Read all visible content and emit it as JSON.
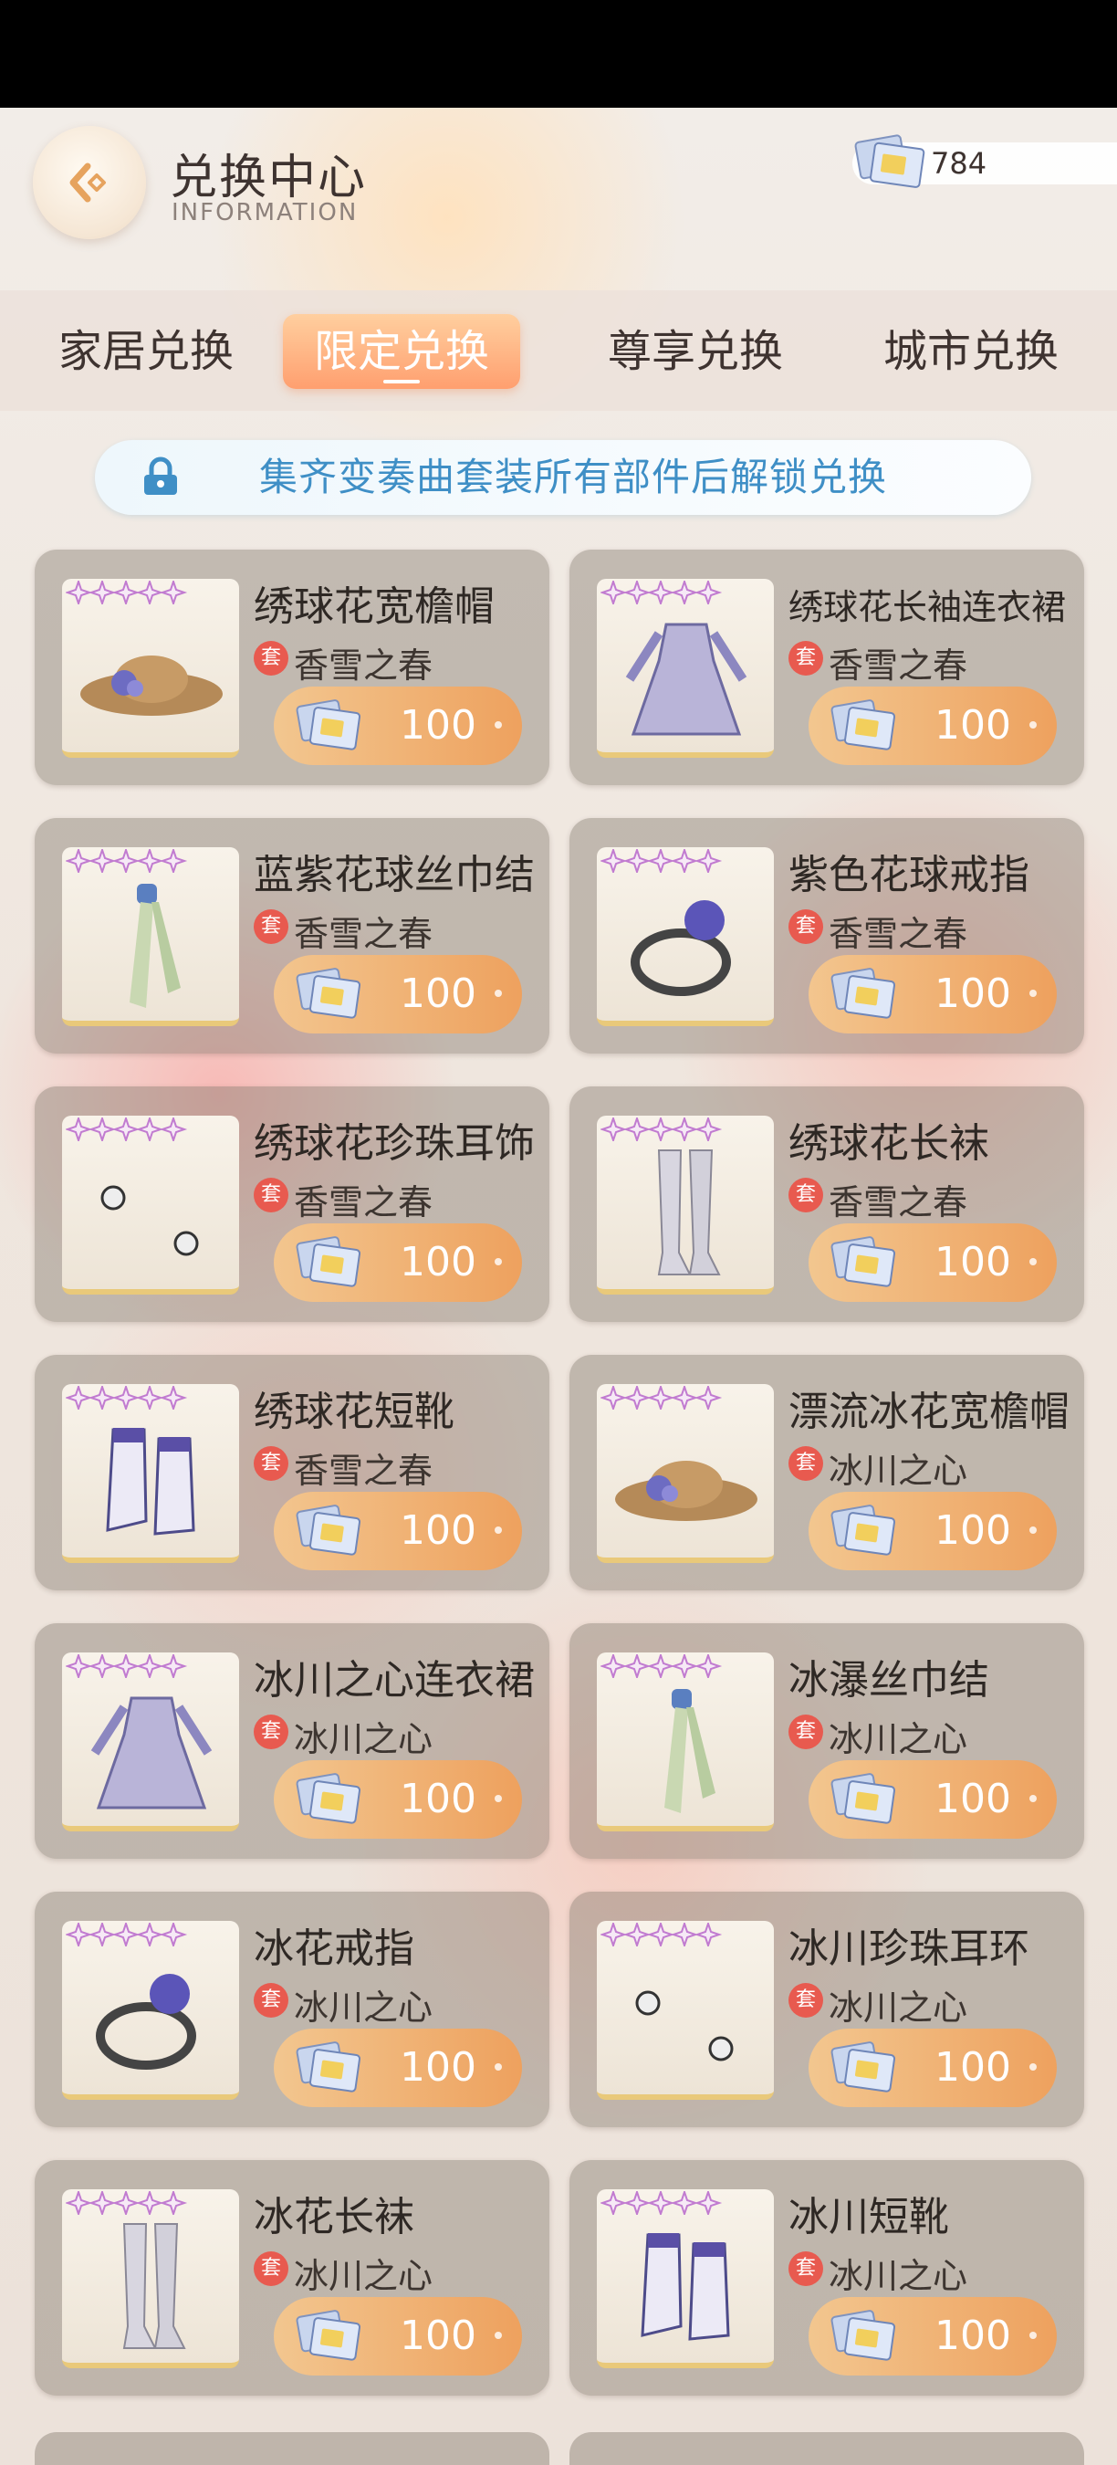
{
  "header": {
    "title": "兑换中心",
    "subtitle": "INFORMATION",
    "currency_value": "784"
  },
  "tabs": [
    {
      "label": "家居兑换",
      "active": false
    },
    {
      "label": "限定兑换",
      "active": true
    },
    {
      "label": "尊享兑换",
      "active": false
    },
    {
      "label": "城市兑换",
      "active": false
    }
  ],
  "notice": {
    "text": "集齐变奏曲套装所有部件后解锁兑换"
  },
  "items": [
    {
      "name": "绣球花宽檐帽",
      "set_badge": "套",
      "set": "香雪之春",
      "price": "100",
      "icon": "hat-icon"
    },
    {
      "name": "绣球花长袖连衣裙",
      "set_badge": "套",
      "set": "香雪之春",
      "price": "100",
      "icon": "dress-icon"
    },
    {
      "name": "蓝紫花球丝巾结",
      "set_badge": "套",
      "set": "香雪之春",
      "price": "100",
      "icon": "scarf-icon"
    },
    {
      "name": "紫色花球戒指",
      "set_badge": "套",
      "set": "香雪之春",
      "price": "100",
      "icon": "ring-icon"
    },
    {
      "name": "绣球花珍珠耳饰",
      "set_badge": "套",
      "set": "香雪之春",
      "price": "100",
      "icon": "earring-icon"
    },
    {
      "name": "绣球花长袜",
      "set_badge": "套",
      "set": "香雪之春",
      "price": "100",
      "icon": "stockings-icon"
    },
    {
      "name": "绣球花短靴",
      "set_badge": "套",
      "set": "香雪之春",
      "price": "100",
      "icon": "boots-icon"
    },
    {
      "name": "漂流冰花宽檐帽",
      "set_badge": "套",
      "set": "冰川之心",
      "price": "100",
      "icon": "hat-icon"
    },
    {
      "name": "冰川之心连衣裙",
      "set_badge": "套",
      "set": "冰川之心",
      "price": "100",
      "icon": "dress-icon"
    },
    {
      "name": "冰瀑丝巾结",
      "set_badge": "套",
      "set": "冰川之心",
      "price": "100",
      "icon": "scarf-icon"
    },
    {
      "name": "冰花戒指",
      "set_badge": "套",
      "set": "冰川之心",
      "price": "100",
      "icon": "ring-icon"
    },
    {
      "name": "冰川珍珠耳环",
      "set_badge": "套",
      "set": "冰川之心",
      "price": "100",
      "icon": "earring-icon"
    },
    {
      "name": "冰花长袜",
      "set_badge": "套",
      "set": "冰川之心",
      "price": "100",
      "icon": "stockings-icon"
    },
    {
      "name": "冰川短靴",
      "set_badge": "套",
      "set": "冰川之心",
      "price": "100",
      "icon": "boots-icon"
    }
  ]
}
